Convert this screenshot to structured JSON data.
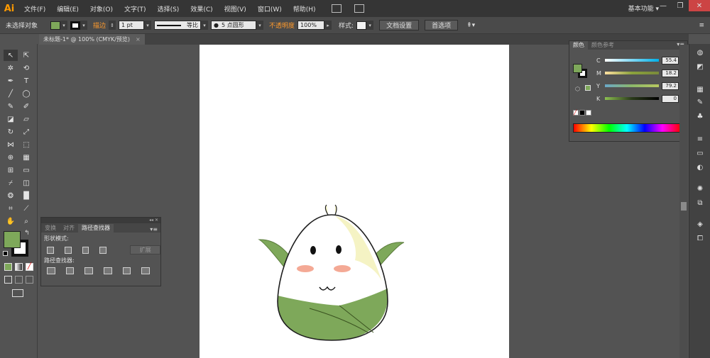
{
  "menubar": {
    "logo": "Ai",
    "items": [
      "文件(F)",
      "编辑(E)",
      "对象(O)",
      "文字(T)",
      "选择(S)",
      "效果(C)",
      "视图(V)",
      "窗口(W)",
      "帮助(H)"
    ],
    "workspace": "基本功能 ▾",
    "window_buttons": [
      "—",
      "❐",
      "✕"
    ]
  },
  "controlbar": {
    "selection_state": "未选择对象",
    "fill_color": "#7ea85a",
    "stroke_link": "描边",
    "stroke_weight": "1 pt",
    "stroke_profile": "等比",
    "brush_size": "5 点圆形",
    "opacity_link": "不透明度",
    "opacity_value": "100%",
    "style_label": "样式:",
    "doc_setup_button": "文档设置",
    "preferences_button": "首选项"
  },
  "document_tab": {
    "title": "未标题-1* @ 100% (CMYK/预览)",
    "close": "×"
  },
  "pathfinder_panel": {
    "collapse": "◂◂ ✕",
    "tabs": [
      "变换",
      "对齐",
      "路径查找器"
    ],
    "active_tab": "路径查找器",
    "shape_modes_label": "形状模式:",
    "expand_button": "扩展",
    "pathfinders_label": "路径查找器:"
  },
  "color_panel": {
    "tabs": [
      "颜色",
      "颜色参考"
    ],
    "active_tab": "颜色",
    "channels": [
      {
        "label": "C",
        "value": "55.4",
        "gradient": "linear-gradient(to right,#fff,#00b0e8)"
      },
      {
        "label": "M",
        "value": "18.2",
        "gradient": "linear-gradient(to right,#ffe0a0,#8ba23c,#7a8a3a)"
      },
      {
        "label": "Y",
        "value": "79.2",
        "gradient": "linear-gradient(to right,#6aa8c8,#8cb86a,#b8c860)"
      },
      {
        "label": "K",
        "value": "0",
        "gradient": "linear-gradient(to right,#8cc050,#2a3a1a,#000)"
      }
    ],
    "percent": "%",
    "fill_color": "#7ea85a"
  },
  "colors": {
    "accent_orange": "#ff9a2c",
    "leaf_green": "#7ea85a",
    "highlight_yellow": "#f5f3c4",
    "blush": "#f29a82"
  }
}
